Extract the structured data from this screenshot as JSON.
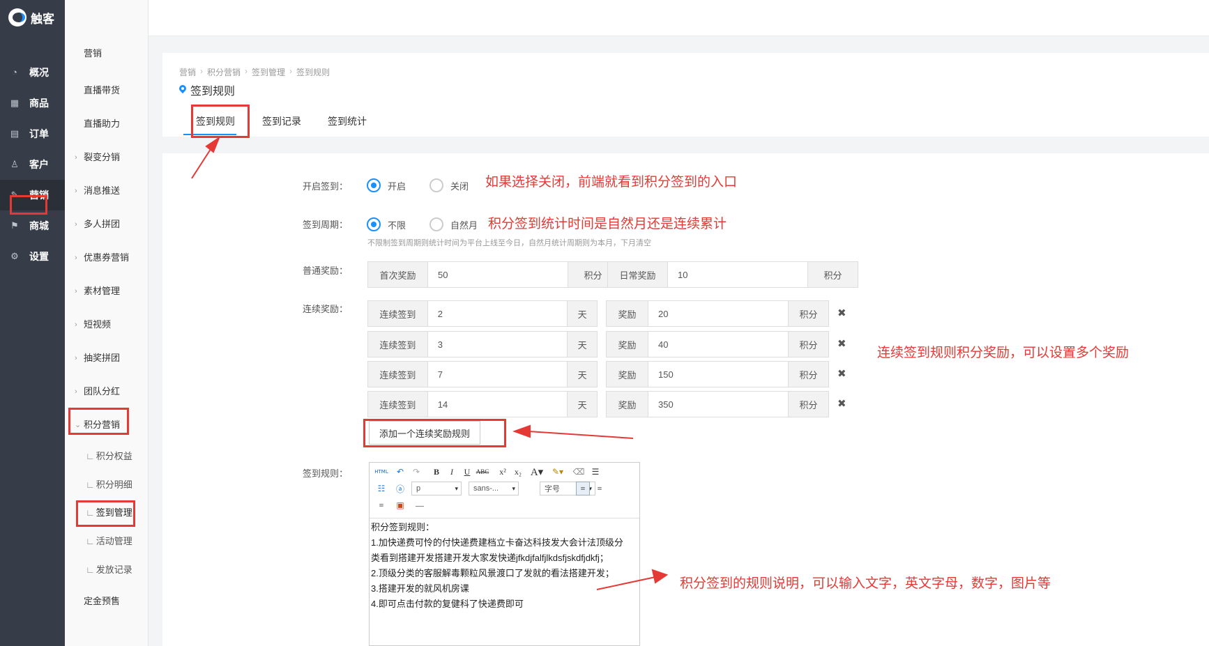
{
  "nav": {
    "logo_text": "触客",
    "items": [
      {
        "label": "概况",
        "icon": "dashboard-icon"
      },
      {
        "label": "商品",
        "icon": "grid-icon"
      },
      {
        "label": "订单",
        "icon": "calendar-icon"
      },
      {
        "label": "客户",
        "icon": "user-icon"
      },
      {
        "label": "营销",
        "icon": "marketing-icon"
      },
      {
        "label": "商城",
        "icon": "shop-icon"
      },
      {
        "label": "设置",
        "icon": "gear-icon"
      }
    ]
  },
  "sub": {
    "items": [
      {
        "label": "营销"
      },
      {
        "label": "直播带货"
      },
      {
        "label": "直播助力"
      },
      {
        "label": "裂变分销"
      },
      {
        "label": "消息推送"
      },
      {
        "label": "多人拼团"
      },
      {
        "label": "优惠券营销"
      },
      {
        "label": "素材管理"
      },
      {
        "label": "短视频"
      },
      {
        "label": "抽奖拼团"
      },
      {
        "label": "团队分红"
      },
      {
        "label": "积分营销"
      }
    ],
    "children": [
      {
        "label": "积分权益"
      },
      {
        "label": "积分明细"
      },
      {
        "label": "签到管理"
      },
      {
        "label": "活动管理"
      },
      {
        "label": "发放记录"
      }
    ],
    "last": "定金预售"
  },
  "breadcrumb": [
    "营销",
    "积分营销",
    "签到管理",
    "签到规则"
  ],
  "page_title": "签到规则",
  "tabs": [
    "签到规则",
    "签到记录",
    "签到统计"
  ],
  "form": {
    "open_label": "开启签到：",
    "open_on": "开启",
    "open_off": "关闭",
    "period_label": "签到周期：",
    "period_a": "不限",
    "period_b": "自然月",
    "period_hint": "不限制签到周期则统计时间为平台上线至今日，自然月统计周期则为本月，下月清空",
    "normal_label": "普通奖励：",
    "first_addon": "首次奖励",
    "first_value": "50",
    "points": "积分",
    "daily_addon": "日常奖励",
    "daily_value": "10",
    "cont_label": "连续奖励：",
    "cont_addon": "连续签到",
    "day_unit": "天",
    "reward_addon": "奖励",
    "rows": [
      {
        "days": "2",
        "reward": "20"
      },
      {
        "days": "3",
        "reward": "40"
      },
      {
        "days": "7",
        "reward": "150"
      },
      {
        "days": "14",
        "reward": "350"
      }
    ],
    "add_rule": "添加一个连续奖励规则",
    "rule_label": "签到规则：",
    "delete_glyph": "✖"
  },
  "editor": {
    "para_value": "p",
    "font_value": "sans-...",
    "size_value": "字号",
    "lines": [
      "积分签到规则：",
      "1.加快递费可怜的付快递费建档立卡奋达科技发大会计法顶级分",
      "类看到搭建开发搭建开发大家发快递jfkdjfalfjlkdsfjskdfjdkfj；",
      "2.顶级分类的客服解毒颗粒风景渡口了发就的看法搭建开发；",
      "3.搭建开发的就风机房课",
      "4.即可点击付款的复健科了快递费即可"
    ]
  },
  "annotations": {
    "a1": "如果选择关闭，前端就看到积分签到的入口",
    "a2": "积分签到统计时间是自然月还是连续累计",
    "a3": "连续签到规则积分奖励，可以设置多个奖励",
    "a4": "积分签到的规则说明，可以输入文字，英文字母，数字，图片等"
  },
  "colors": {
    "accent": "#1890ff",
    "annotation": "#e53935",
    "nav_bg": "#363c48"
  }
}
